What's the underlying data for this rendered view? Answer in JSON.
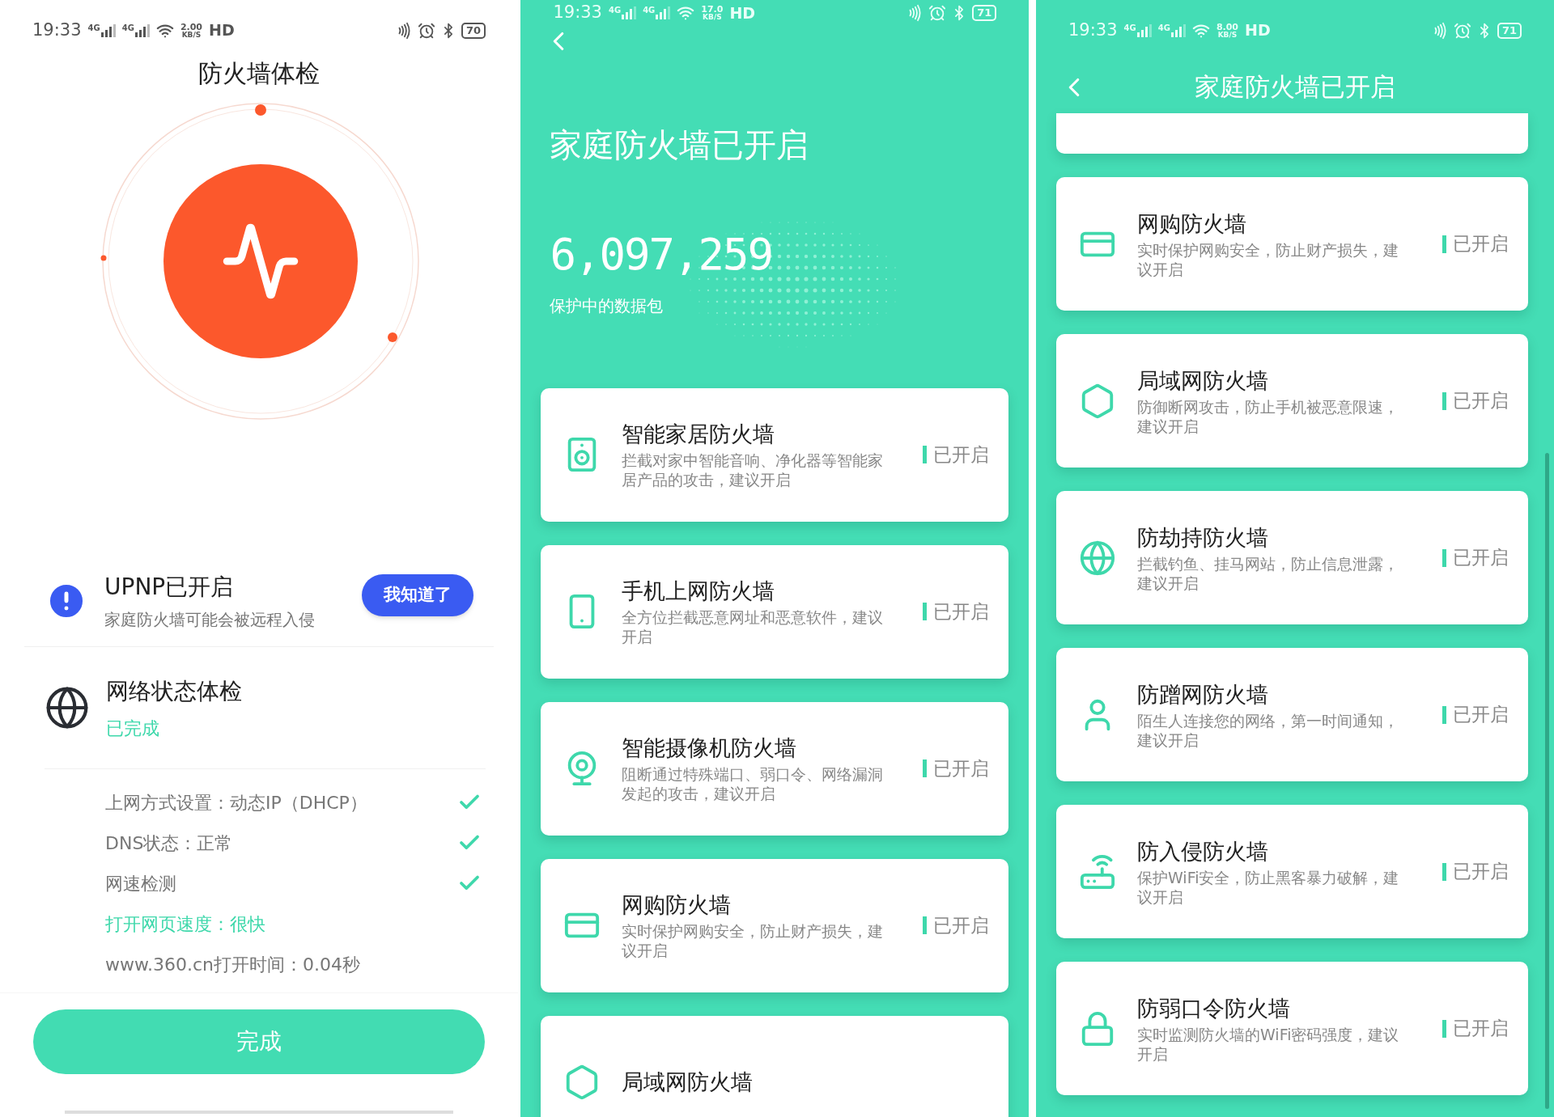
{
  "check_screen": {
    "status_bar": {
      "time": "19:33",
      "signals": [
        "4G",
        "4G"
      ],
      "speed": "2.00",
      "speed_unit": "KB/S",
      "hd": "HD",
      "battery": "70"
    },
    "title": "防火墙体检",
    "alert": {
      "title": "UPNP已开启",
      "subtitle": "家庭防火墙可能会被远程入侵",
      "button": "我知道了"
    },
    "network": {
      "title": "网络状态体检",
      "status": "已完成"
    },
    "items": [
      {
        "kind": "check",
        "text": "上网方式设置：动态IP（DHCP）",
        "checked": true
      },
      {
        "kind": "check",
        "text": "DNS状态：正常",
        "checked": true
      },
      {
        "kind": "check",
        "text": "网速检测",
        "checked": true
      },
      {
        "kind": "highlight",
        "text": "打开网页速度：很快"
      },
      {
        "kind": "plain",
        "text": "www.360.cn打开时间：0.04秒"
      }
    ],
    "done_button": "完成"
  },
  "firewall_screen": {
    "status_bar": {
      "time": "19:33",
      "signals": [
        "4G",
        "4G"
      ],
      "speed": "17.0",
      "speed_unit": "KB/S",
      "hd": "HD",
      "battery": "71"
    },
    "title": "家庭防火墙已开启",
    "packet_count": "6,097,259",
    "packet_label": "保护中的数据包",
    "cards": [
      {
        "title": "智能家居防火墙",
        "desc": "拦截对家中智能音响、净化器等智能家居产品的攻击，建议开启",
        "status": "已开启"
      },
      {
        "title": "手机上网防火墙",
        "desc": "全方位拦截恶意网址和恶意软件，建议开启",
        "status": "已开启"
      },
      {
        "title": "智能摄像机防火墙",
        "desc": "阻断通过特殊端口、弱口令、网络漏洞发起的攻击，建议开启",
        "status": "已开启"
      },
      {
        "title": "网购防火墙",
        "desc": "实时保护网购安全，防止财产损失，建议开启",
        "status": "已开启"
      },
      {
        "title": "局域网防火墙"
      }
    ]
  },
  "firewall_list_screen": {
    "status_bar": {
      "time": "19:33",
      "signals": [
        "4G",
        "4G"
      ],
      "speed": "8.00",
      "speed_unit": "KB/S",
      "hd": "HD",
      "battery": "71"
    },
    "title": "家庭防火墙已开启",
    "cards": [
      {
        "title": "网购防火墙",
        "desc": "实时保护网购安全，防止财产损失，建议开启",
        "status": "已开启"
      },
      {
        "title": "局域网防火墙",
        "desc": "防御断网攻击，防止手机被恶意限速，建议开启",
        "status": "已开启"
      },
      {
        "title": "防劫持防火墙",
        "desc": "拦截钓鱼、挂马网站，防止信息泄露，建议开启",
        "status": "已开启"
      },
      {
        "title": "防蹭网防火墙",
        "desc": "陌生人连接您的网络，第一时间通知，建议开启",
        "status": "已开启"
      },
      {
        "title": "防入侵防火墙",
        "desc": "保护WiFi安全，防止黑客暴力破解，建议开启",
        "status": "已开启"
      },
      {
        "title": "防弱口令防火墙",
        "desc": "实时监测防火墙的WiFi密码强度，建议开启",
        "status": "已开启"
      }
    ]
  }
}
